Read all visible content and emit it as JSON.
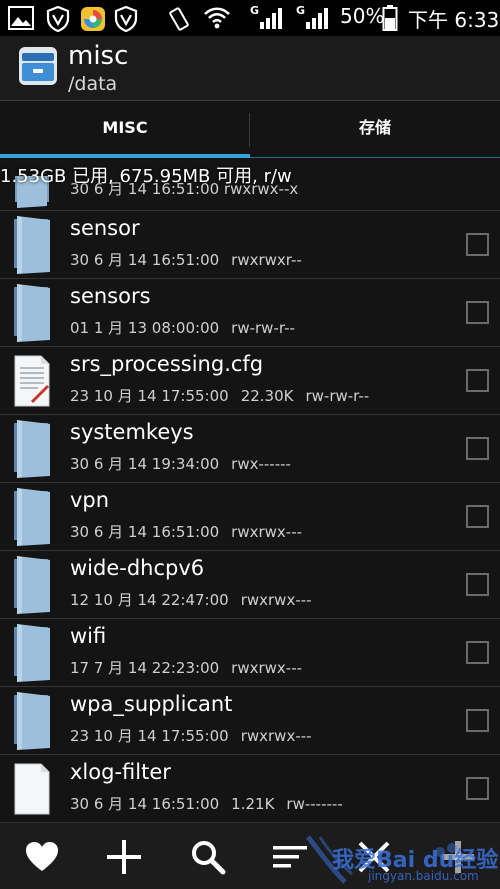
{
  "status_bar": {
    "battery_percent": "50%",
    "time": "下午 6:33",
    "signal_label_1": "G",
    "signal_label_2": "G"
  },
  "header": {
    "title": "misc",
    "path": "/data"
  },
  "tabs": [
    {
      "label": "MISC",
      "active": true
    },
    {
      "label": "存储",
      "active": false
    }
  ],
  "storage_info": "1.53GB 已用, 675.95MB 可用, r/w",
  "partial_row_meta": "30 6 月 14 16:51:00   rwxrwx--x",
  "files": [
    {
      "name": "sensor",
      "date": "30 6 月 14 16:51:00",
      "size": "",
      "perms": "rwxrwxr--",
      "type": "folder",
      "checked": false
    },
    {
      "name": "sensors",
      "date": "01 1 月 13 08:00:00",
      "size": "",
      "perms": "rw-rw-r--",
      "type": "folder",
      "checked": false
    },
    {
      "name": "srs_processing.cfg",
      "date": "23 10 月 14 17:55:00",
      "size": "22.30K",
      "perms": "rw-rw-r--",
      "type": "text-file",
      "checked": false
    },
    {
      "name": "systemkeys",
      "date": "30 6 月 14 19:34:00",
      "size": "",
      "perms": "rwx------",
      "type": "folder",
      "checked": false
    },
    {
      "name": "vpn",
      "date": "30 6 月 14 16:51:00",
      "size": "",
      "perms": "rwxrwx---",
      "type": "folder",
      "checked": false
    },
    {
      "name": "wide-dhcpv6",
      "date": "12 10 月 14 22:47:00",
      "size": "",
      "perms": "rwxrwx---",
      "type": "folder",
      "checked": false
    },
    {
      "name": "wifi",
      "date": "17 7 月 14 22:23:00",
      "size": "",
      "perms": "rwxrwx---",
      "type": "folder",
      "checked": false
    },
    {
      "name": "wpa_supplicant",
      "date": "23 10 月 14 17:55:00",
      "size": "",
      "perms": "rwxrwx---",
      "type": "folder",
      "checked": false
    },
    {
      "name": "xlog-filter",
      "date": "30 6 月 14 16:51:00",
      "size": "1.21K",
      "perms": "rw-------",
      "type": "file",
      "checked": false
    }
  ],
  "toolbar": [
    {
      "icon": "heart-icon"
    },
    {
      "icon": "plus-icon"
    },
    {
      "icon": "search-icon"
    },
    {
      "icon": "sort-icon"
    },
    {
      "icon": "close-icon"
    },
    {
      "icon": "add-icon"
    }
  ],
  "watermark": {
    "text": "我爱Bai du经验",
    "url": "jingyan.baidu.com"
  },
  "colors": {
    "accent": "#33a3dc",
    "folder": "#7a9fbe",
    "background": "#141414"
  }
}
